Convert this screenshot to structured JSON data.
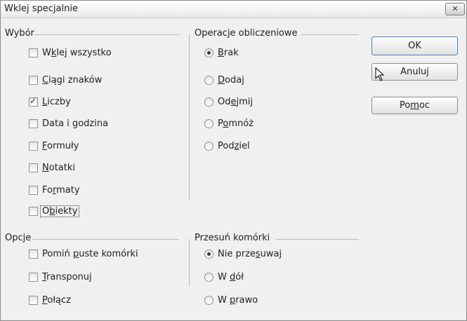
{
  "window": {
    "title": "Wklej specjalnie",
    "close_label": "✕"
  },
  "selection_group": {
    "title": "Wybór",
    "items": [
      {
        "pre": "W",
        "key": "k",
        "post": "lej wszystko",
        "checked": false
      },
      {
        "pre": "",
        "key": "C",
        "post": "iągi znaków",
        "checked": false
      },
      {
        "pre": "",
        "key": "L",
        "post": "iczby",
        "checked": true
      },
      {
        "pre": "Data i ",
        "key": "g",
        "post": "odzina",
        "checked": false
      },
      {
        "pre": "",
        "key": "F",
        "post": "ormuły",
        "checked": false
      },
      {
        "pre": "",
        "key": "N",
        "post": "otatki",
        "checked": false
      },
      {
        "pre": "Fo",
        "key": "r",
        "post": "maty",
        "checked": false
      },
      {
        "pre": "O",
        "key": "b",
        "post": "iekty",
        "checked": false
      }
    ]
  },
  "operations_group": {
    "title": "Operacje obliczeniowe",
    "items": [
      {
        "pre": "",
        "key": "B",
        "post": "rak",
        "checked": true
      },
      {
        "pre": "",
        "key": "D",
        "post": "odaj",
        "checked": false
      },
      {
        "pre": "Od",
        "key": "e",
        "post": "jmij",
        "checked": false
      },
      {
        "pre": "P",
        "key": "o",
        "post": "mnóż",
        "checked": false
      },
      {
        "pre": "Pod",
        "key": "z",
        "post": "iel",
        "checked": false
      }
    ]
  },
  "options_group": {
    "title": "Opcje",
    "items": [
      {
        "pre": "Pomiń ",
        "key": "p",
        "post": "uste komórki",
        "checked": false
      },
      {
        "pre": "",
        "key": "T",
        "post": "ransponuj",
        "checked": false
      },
      {
        "pre": "",
        "key": "P",
        "post": "ołącz",
        "checked": false
      }
    ]
  },
  "shift_group": {
    "title": "Przesuń komórki",
    "items": [
      {
        "pre": "Nie prze",
        "key": "s",
        "post": "uwaj",
        "checked": true
      },
      {
        "pre": "W ",
        "key": "d",
        "post": "ół",
        "checked": false
      },
      {
        "pre": "W ",
        "key": "p",
        "post": "rawo",
        "checked": false
      }
    ]
  },
  "buttons": {
    "ok": "OK",
    "cancel": "Anuluj",
    "help_pre": "Po",
    "help_key": "m",
    "help_post": "oc"
  }
}
